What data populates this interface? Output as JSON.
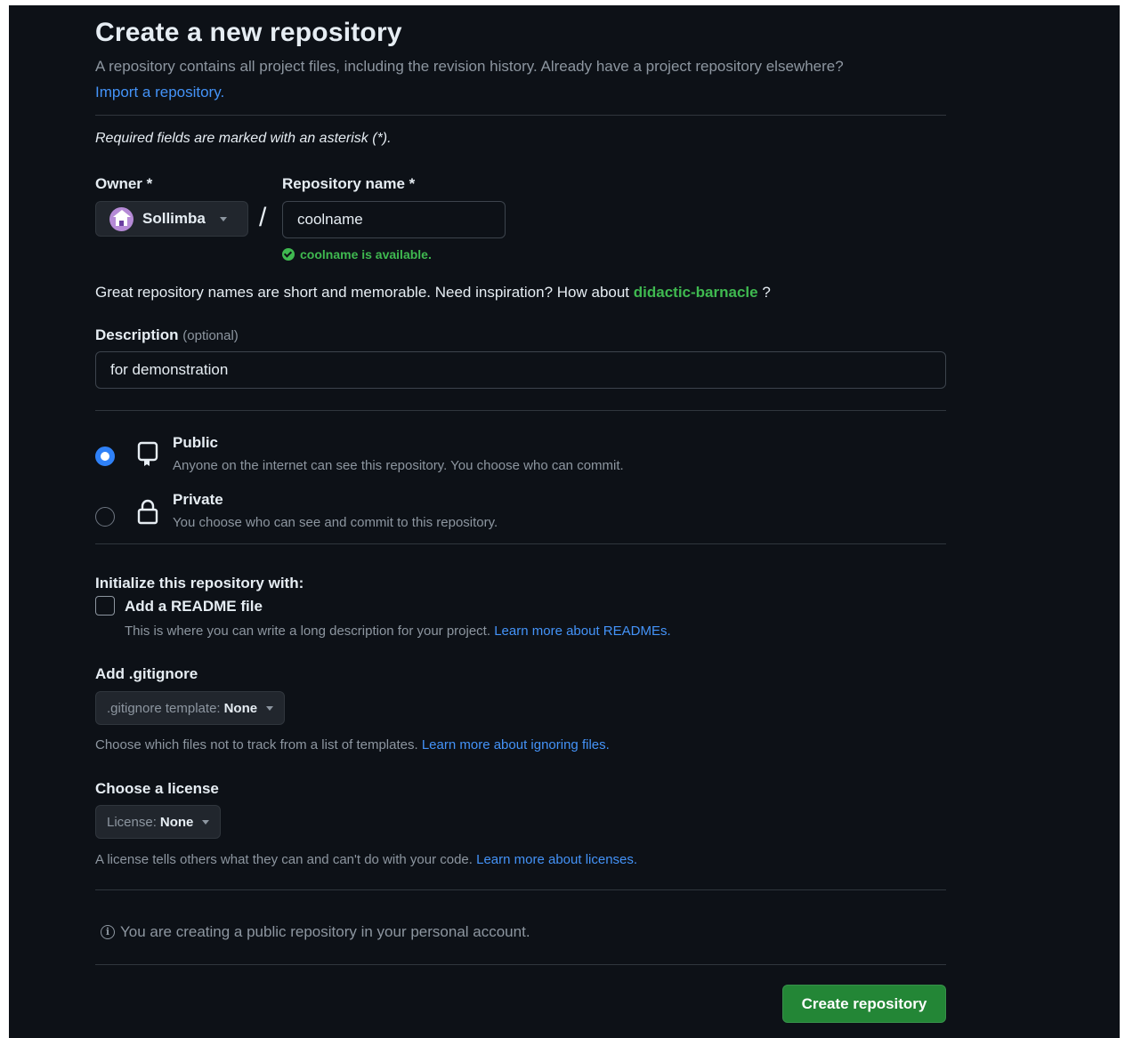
{
  "header": {
    "title": "Create a new repository",
    "subtitle": "A repository contains all project files, including the revision history. Already have a project repository elsewhere?",
    "import_link": "Import a repository."
  },
  "required_note": "Required fields are marked with an asterisk (*).",
  "owner": {
    "label": "Owner *",
    "name": "Sollimba",
    "avatar_color": "#b58ad6"
  },
  "separator": "/",
  "repo_name": {
    "label": "Repository name *",
    "value": "coolname",
    "availability": "coolname is available."
  },
  "suggestion": {
    "prefix": "Great repository names are short and memorable. Need inspiration? How about ",
    "name": "didactic-barnacle",
    "suffix": " ?"
  },
  "description": {
    "label": "Description",
    "optional": "(optional)",
    "value": "for demonstration"
  },
  "visibility": {
    "selected": "public",
    "public": {
      "title": "Public",
      "desc": "Anyone on the internet can see this repository. You choose who can commit."
    },
    "private": {
      "title": "Private",
      "desc": "You choose who can see and commit to this repository."
    }
  },
  "initialize": {
    "label": "Initialize this repository with:",
    "readme": {
      "label": "Add a README file",
      "checked": false,
      "desc": "This is where you can write a long description for your project. ",
      "link": "Learn more about READMEs."
    }
  },
  "gitignore": {
    "label": "Add .gitignore",
    "select_prefix": ".gitignore template:",
    "select_value": "None",
    "help": "Choose which files not to track from a list of templates. ",
    "link": "Learn more about ignoring files."
  },
  "license": {
    "label": "Choose a license",
    "select_prefix": "License:",
    "select_value": "None",
    "help": "A license tells others what they can and can't do with your code. ",
    "link": "Learn more about licenses."
  },
  "info": "You are creating a public repository in your personal account.",
  "submit_label": "Create repository",
  "colors": {
    "background": "#0d1117",
    "accent_blue": "#2f81f7",
    "link": "#4493f8",
    "success": "#3fb950",
    "button_green": "#238636",
    "muted": "#8d96a0"
  }
}
